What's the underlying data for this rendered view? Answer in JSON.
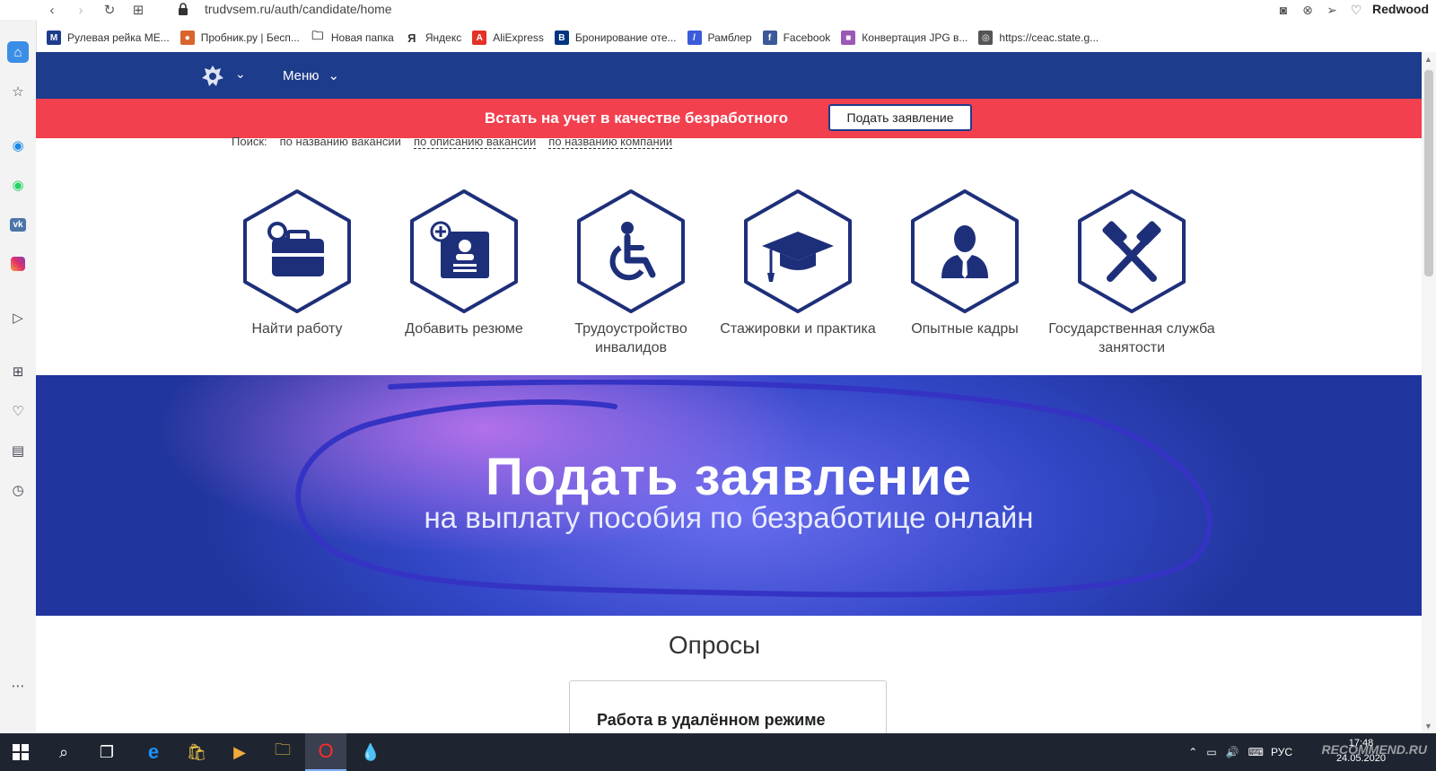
{
  "browser": {
    "url": "trudvsem.ru/auth/candidate/home",
    "profile_name": "Redwood",
    "bookmarks": [
      {
        "label": "Рулевая рейка МЕ...",
        "color": "#1e3c8c",
        "glyph": "M"
      },
      {
        "label": "Пробник.ру | Бесп...",
        "color": "#d9652c",
        "glyph": "●"
      },
      {
        "label": "Новая папка",
        "color": "#ffffff",
        "glyph": "🗀"
      },
      {
        "label": "Яндекс",
        "color": "#ffffff",
        "glyph": "Я"
      },
      {
        "label": "AliExpress",
        "color": "#e43226",
        "glyph": "A"
      },
      {
        "label": "Бронирование оте...",
        "color": "#003580",
        "glyph": "B"
      },
      {
        "label": "Рамблер",
        "color": "#3b5bdb",
        "glyph": "/"
      },
      {
        "label": "Facebook",
        "color": "#3b5998",
        "glyph": "f"
      },
      {
        "label": "Конвертация JPG в...",
        "color": "#9b59b6",
        "glyph": "■"
      },
      {
        "label": "https://ceac.state.g...",
        "color": "#555555",
        "glyph": "◎"
      }
    ]
  },
  "header": {
    "menu_label": "Меню"
  },
  "banner": {
    "text": "Встать на учет в качестве безработного",
    "button_label": "Подать заявление"
  },
  "search": {
    "label": "Поиск:",
    "options": [
      "по названию вакансии",
      "по описанию вакансии",
      "по названию компании"
    ]
  },
  "categories": [
    {
      "label": "Найти работу",
      "icon": "briefcase-search-icon"
    },
    {
      "label": "Добавить резюме",
      "icon": "resume-add-icon"
    },
    {
      "label": "Трудоустройство инвалидов",
      "icon": "wheelchair-icon"
    },
    {
      "label": "Стажировки и практика",
      "icon": "graduation-cap-icon"
    },
    {
      "label": "Опытные кадры",
      "icon": "businessman-icon"
    },
    {
      "label": "Государственная служба занятости",
      "icon": "hammers-icon"
    }
  ],
  "hero": {
    "title": "Подать заявление",
    "subtitle": "на выплату пособия по безработице онлайн"
  },
  "polls": {
    "title": "Опросы",
    "card_title": "Работа в удалённом режиме"
  },
  "taskbar": {
    "time": "17:48",
    "date": "24.05.2020",
    "lang": "РУС",
    "watermark": "RECOMMEND.RU"
  },
  "colors": {
    "header_blue": "#1e3c8c",
    "banner_red": "#f2404f",
    "icon_navy": "#1e2f7a"
  }
}
